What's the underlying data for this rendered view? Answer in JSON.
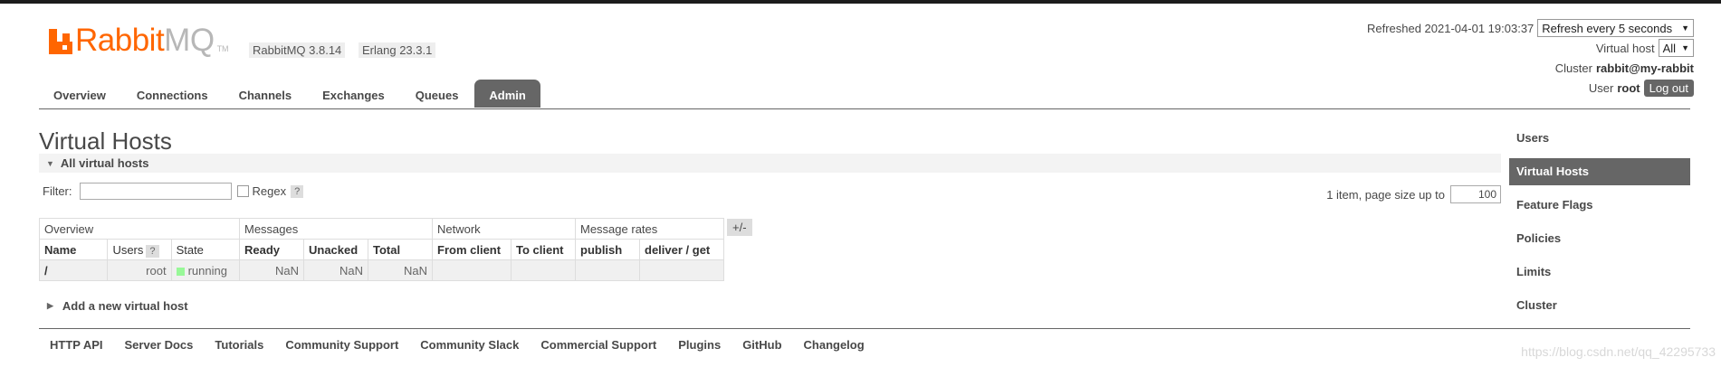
{
  "brand": {
    "name_part1": "Rabbit",
    "name_part2": "MQ",
    "tm": "TM",
    "brand_color": "#ff6600"
  },
  "versions": {
    "rabbitmq": "RabbitMQ 3.8.14",
    "erlang": "Erlang 23.3.1"
  },
  "status": {
    "refreshed_label": "Refreshed 2021-04-01 19:03:37",
    "refresh_option": "Refresh every 5 seconds",
    "vhost_label": "Virtual host",
    "vhost_value": "All",
    "cluster_label": "Cluster",
    "cluster_value": "rabbit@my-rabbit",
    "user_label": "User",
    "user_value": "root",
    "logout": "Log out"
  },
  "tabs": [
    {
      "label": "Overview"
    },
    {
      "label": "Connections"
    },
    {
      "label": "Channels"
    },
    {
      "label": "Exchanges"
    },
    {
      "label": "Queues"
    },
    {
      "label": "Admin",
      "active": true
    }
  ],
  "page_title": "Virtual Hosts",
  "section_title": "All virtual hosts",
  "filter": {
    "label": "Filter:",
    "value": "",
    "regex_label": "Regex",
    "help": "?"
  },
  "paging": {
    "text": "1 item, page size up to",
    "page_size": "100"
  },
  "table": {
    "groups": [
      "Overview",
      "Messages",
      "Network",
      "Message rates"
    ],
    "headers": [
      "Name",
      "Users",
      "State",
      "Ready",
      "Unacked",
      "Total",
      "From client",
      "To client",
      "publish",
      "deliver / get"
    ],
    "users_help": "?",
    "rows": [
      {
        "name": "/",
        "users": "root",
        "state": "running",
        "ready": "NaN",
        "unacked": "NaN",
        "total": "NaN",
        "from_client": "",
        "to_client": "",
        "publish": "",
        "deliver_get": ""
      }
    ],
    "columns_toggle": "+/-"
  },
  "add_host": "Add a new virtual host",
  "right_menu": [
    {
      "label": "Users"
    },
    {
      "label": "Virtual Hosts",
      "active": true
    },
    {
      "label": "Feature Flags"
    },
    {
      "label": "Policies"
    },
    {
      "label": "Limits"
    },
    {
      "label": "Cluster"
    }
  ],
  "footer": [
    "HTTP API",
    "Server Docs",
    "Tutorials",
    "Community Support",
    "Community Slack",
    "Commercial Support",
    "Plugins",
    "GitHub",
    "Changelog"
  ],
  "watermark": "https://blog.csdn.net/qq_42295733",
  "colors": {
    "tab_active_bg": "#666666",
    "running_indicator": "#98f898"
  }
}
